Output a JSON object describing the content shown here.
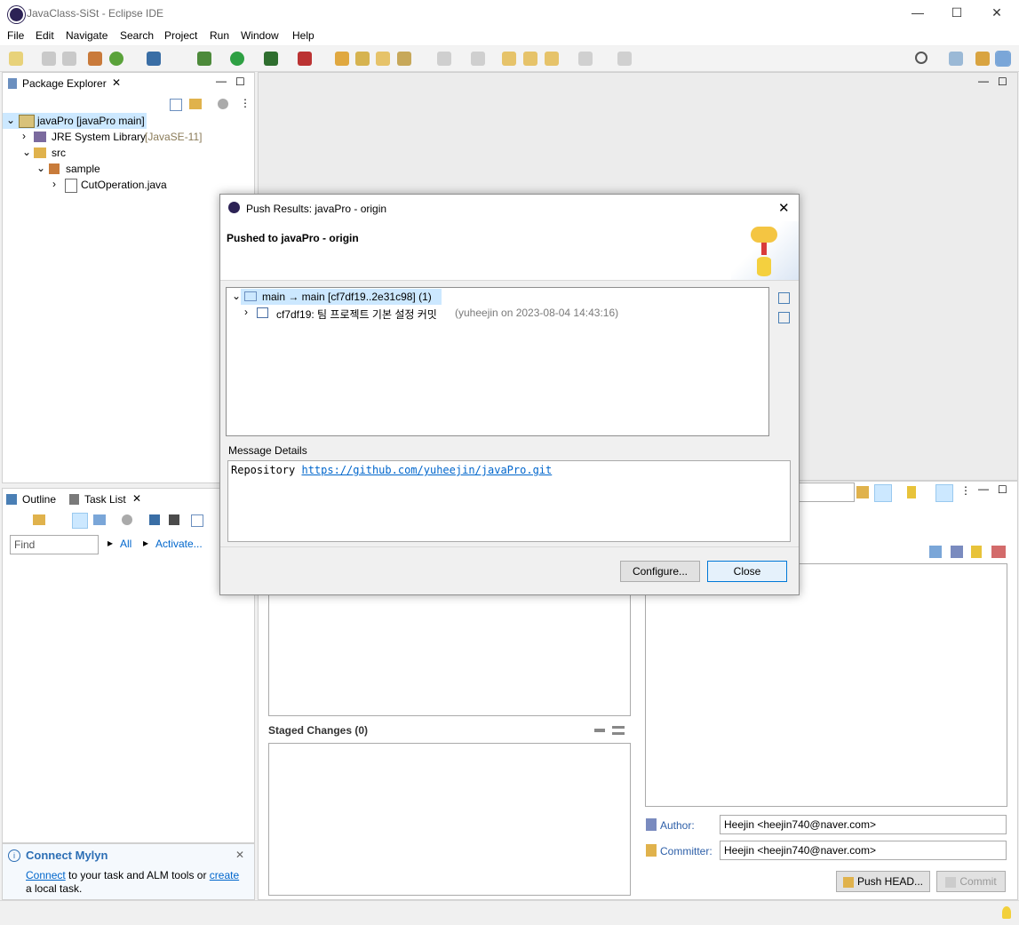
{
  "window": {
    "title": "JavaClass-SiSt - Eclipse IDE",
    "min": "—",
    "max": "☐",
    "close": "✕"
  },
  "menu": [
    "File",
    "Edit",
    "Navigate",
    "Search",
    "Project",
    "Run",
    "Window",
    "Help"
  ],
  "package_explorer": {
    "tab": "Package Explorer",
    "tree": [
      {
        "label": "javaPro [javaPro main]"
      },
      {
        "label": "JRE System Library",
        "extra": "[JavaSE-11]"
      },
      {
        "label": "src"
      },
      {
        "label": "sample"
      },
      {
        "label": "CutOperation.java"
      }
    ]
  },
  "outline": {
    "tab1": "Outline",
    "tab2": "Task List",
    "find_placeholder": "Find",
    "all": "All",
    "activate": "Activate..."
  },
  "mylyn": {
    "title": "Connect Mylyn",
    "link1": "Connect",
    "text1": " to your task and ALM tools or ",
    "link2": "create",
    "text2": "a local task."
  },
  "staging": {
    "staged_title": "Staged Changes (0)",
    "author_label": "Author:",
    "author_value": "Heejin <heejin740@naver.com>",
    "committer_label": "Committer:",
    "committer_value": "Heejin <heejin740@naver.com>",
    "push_button": "Push HEAD...",
    "commit_button": "Commit"
  },
  "dialog": {
    "title": "Push Results: javaPro - origin",
    "heading": "Pushed to javaPro - origin",
    "ref_row": "main → main [cf7df19..2e31c98] (1)",
    "commit_row": "cf7df19: 팀 프로젝트 기본 설정 커밋",
    "commit_meta": "(yuheejin on 2023-08-04 14:43:16)",
    "details_label": "Message Details",
    "repo_prefix": "Repository",
    "repo_url": "https://github.com/yuheejin/javaPro.git",
    "configure_button": "Configure...",
    "close_button": "Close"
  },
  "colors": {
    "accent": "#0078d7",
    "link": "#0066cc",
    "selection": "#cce8ff"
  }
}
